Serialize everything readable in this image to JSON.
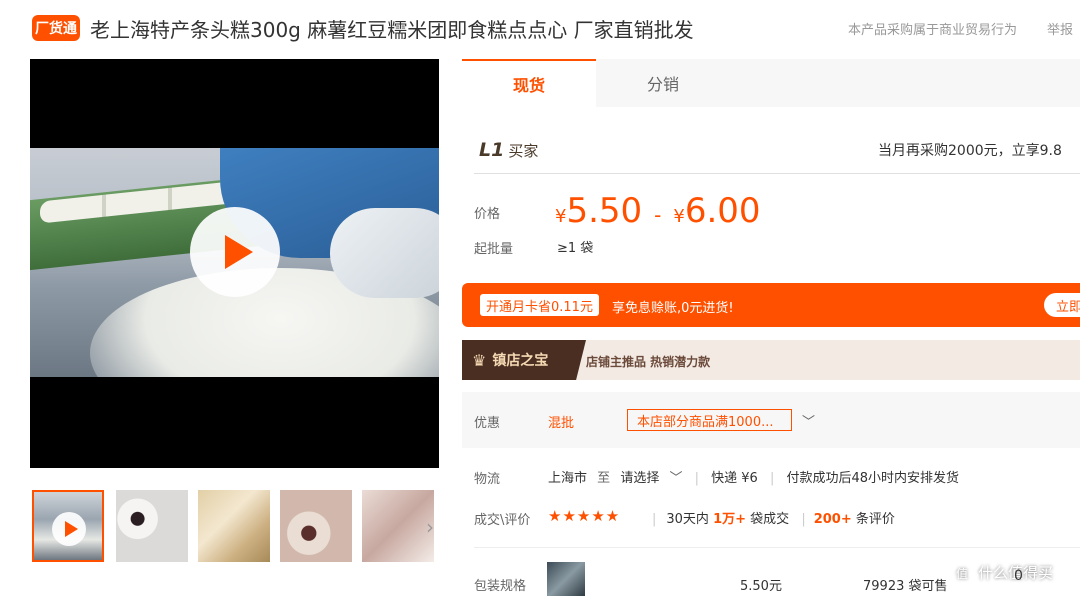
{
  "header": {
    "badge": "厂货通",
    "title": "老上海特产条头糕300g 麻薯红豆糯米团即食糕点点心 厂家直销批发",
    "notice": "本产品采购属于商业贸易行为",
    "report": "举报"
  },
  "tabs": [
    {
      "label": "现货",
      "active": true
    },
    {
      "label": "分销",
      "active": false
    }
  ],
  "buyer": {
    "level": "L1",
    "level_label": "买家",
    "promo": "当月再采购2000元，立享9.8"
  },
  "price": {
    "label": "价格",
    "currency": "¥",
    "low": "5.50",
    "dash": "-",
    "high": "6.00",
    "moq_label": "起批量",
    "moq_value": "≥1 袋"
  },
  "banner": {
    "pill": "开通月卡省0.11元",
    "text": "享免息赊账,0元进货!",
    "button": "立即"
  },
  "store": {
    "badge": "镇店之宝",
    "tags": "店铺主推品  热销潜力款"
  },
  "offers": {
    "label": "优惠",
    "mix": "混批",
    "coupon": "本店部分商品满1000..."
  },
  "logistics": {
    "label": "物流",
    "from": "上海市",
    "to": "至",
    "select": "请选择",
    "express": "快递 ¥6",
    "dispatch": "付款成功后48小时内安排发货"
  },
  "rating": {
    "label": "成交\\评价",
    "stars": "★★★★★",
    "deals_prefix": "30天内",
    "deals_count": "1万+",
    "deals_suffix": "袋成交",
    "reviews_count": "200+",
    "reviews_suffix": "条评价"
  },
  "spec": {
    "label": "包装规格",
    "price": "5.50元",
    "stock": "79923 袋可售",
    "qty": "0"
  },
  "watermark": "什么值得买",
  "thumbs": [
    "video",
    "photo-2",
    "photo-3",
    "photo-4",
    "photo-5"
  ],
  "colors": {
    "accent": "#ff5000",
    "store_dark": "#4a2e22"
  }
}
